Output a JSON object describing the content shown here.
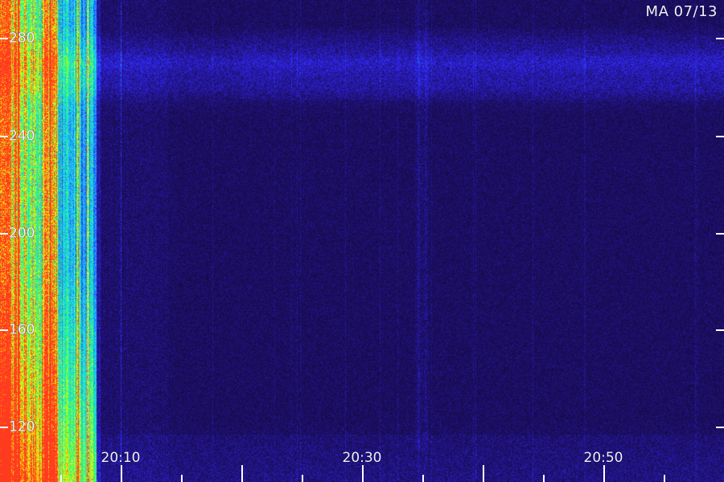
{
  "station_label": "MA 07/13",
  "y_axis": {
    "ticks": [
      "280",
      "240",
      "200",
      "160",
      "120"
    ]
  },
  "x_axis": {
    "ticks": [
      "20:10",
      "20:30",
      "20:50"
    ]
  },
  "colors": {
    "background": "#10062f",
    "noise_low": "#1d0a6b",
    "noise_mid": "#3b2cff",
    "cyan": "#1ad6ff",
    "green": "#2cff6a",
    "yellow": "#ffe600",
    "red": "#ff3b1f",
    "labels": "#eef2ff"
  }
}
